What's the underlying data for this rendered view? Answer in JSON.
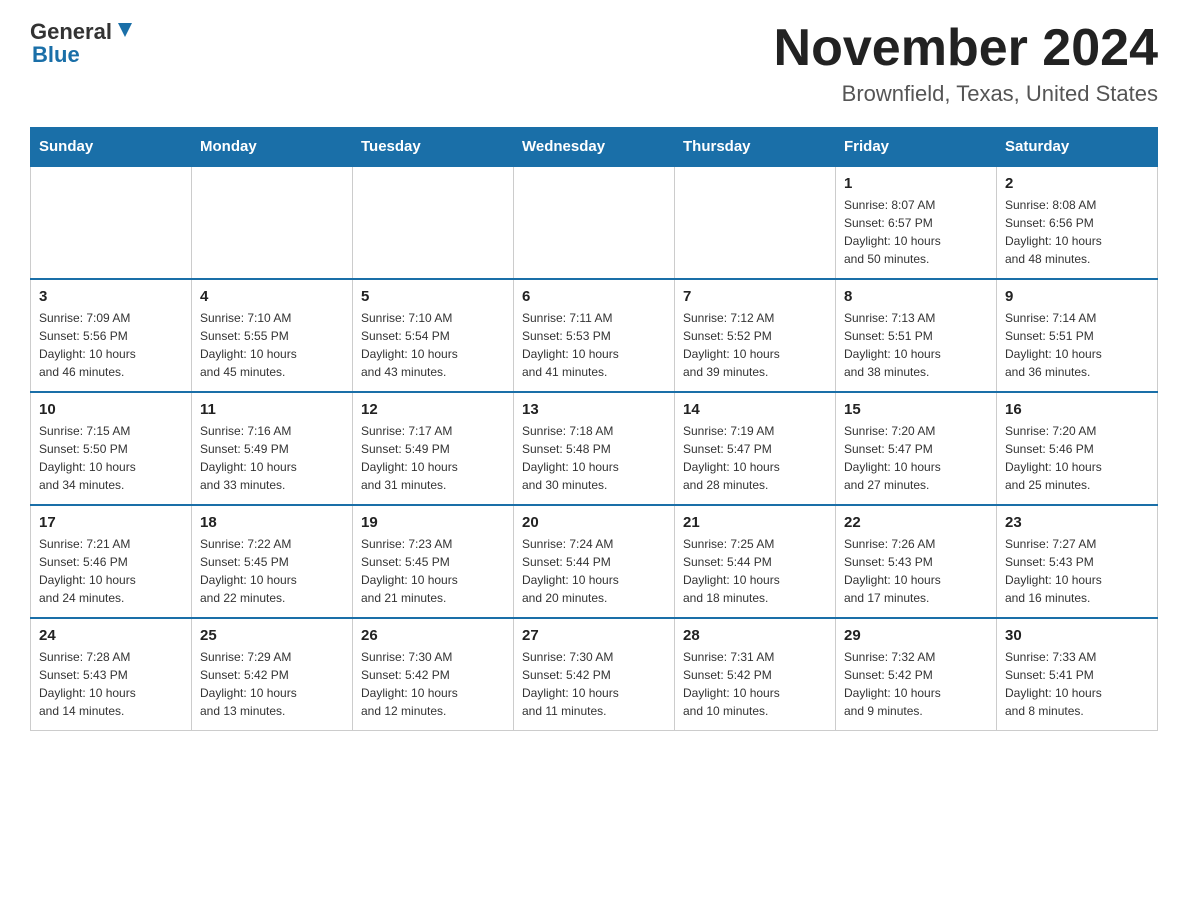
{
  "logo": {
    "text_general": "General",
    "text_blue": "Blue"
  },
  "title": "November 2024",
  "subtitle": "Brownfield, Texas, United States",
  "days_of_week": [
    "Sunday",
    "Monday",
    "Tuesday",
    "Wednesday",
    "Thursday",
    "Friday",
    "Saturday"
  ],
  "weeks": [
    [
      {
        "day": "",
        "info": ""
      },
      {
        "day": "",
        "info": ""
      },
      {
        "day": "",
        "info": ""
      },
      {
        "day": "",
        "info": ""
      },
      {
        "day": "",
        "info": ""
      },
      {
        "day": "1",
        "info": "Sunrise: 8:07 AM\nSunset: 6:57 PM\nDaylight: 10 hours\nand 50 minutes."
      },
      {
        "day": "2",
        "info": "Sunrise: 8:08 AM\nSunset: 6:56 PM\nDaylight: 10 hours\nand 48 minutes."
      }
    ],
    [
      {
        "day": "3",
        "info": "Sunrise: 7:09 AM\nSunset: 5:56 PM\nDaylight: 10 hours\nand 46 minutes."
      },
      {
        "day": "4",
        "info": "Sunrise: 7:10 AM\nSunset: 5:55 PM\nDaylight: 10 hours\nand 45 minutes."
      },
      {
        "day": "5",
        "info": "Sunrise: 7:10 AM\nSunset: 5:54 PM\nDaylight: 10 hours\nand 43 minutes."
      },
      {
        "day": "6",
        "info": "Sunrise: 7:11 AM\nSunset: 5:53 PM\nDaylight: 10 hours\nand 41 minutes."
      },
      {
        "day": "7",
        "info": "Sunrise: 7:12 AM\nSunset: 5:52 PM\nDaylight: 10 hours\nand 39 minutes."
      },
      {
        "day": "8",
        "info": "Sunrise: 7:13 AM\nSunset: 5:51 PM\nDaylight: 10 hours\nand 38 minutes."
      },
      {
        "day": "9",
        "info": "Sunrise: 7:14 AM\nSunset: 5:51 PM\nDaylight: 10 hours\nand 36 minutes."
      }
    ],
    [
      {
        "day": "10",
        "info": "Sunrise: 7:15 AM\nSunset: 5:50 PM\nDaylight: 10 hours\nand 34 minutes."
      },
      {
        "day": "11",
        "info": "Sunrise: 7:16 AM\nSunset: 5:49 PM\nDaylight: 10 hours\nand 33 minutes."
      },
      {
        "day": "12",
        "info": "Sunrise: 7:17 AM\nSunset: 5:49 PM\nDaylight: 10 hours\nand 31 minutes."
      },
      {
        "day": "13",
        "info": "Sunrise: 7:18 AM\nSunset: 5:48 PM\nDaylight: 10 hours\nand 30 minutes."
      },
      {
        "day": "14",
        "info": "Sunrise: 7:19 AM\nSunset: 5:47 PM\nDaylight: 10 hours\nand 28 minutes."
      },
      {
        "day": "15",
        "info": "Sunrise: 7:20 AM\nSunset: 5:47 PM\nDaylight: 10 hours\nand 27 minutes."
      },
      {
        "day": "16",
        "info": "Sunrise: 7:20 AM\nSunset: 5:46 PM\nDaylight: 10 hours\nand 25 minutes."
      }
    ],
    [
      {
        "day": "17",
        "info": "Sunrise: 7:21 AM\nSunset: 5:46 PM\nDaylight: 10 hours\nand 24 minutes."
      },
      {
        "day": "18",
        "info": "Sunrise: 7:22 AM\nSunset: 5:45 PM\nDaylight: 10 hours\nand 22 minutes."
      },
      {
        "day": "19",
        "info": "Sunrise: 7:23 AM\nSunset: 5:45 PM\nDaylight: 10 hours\nand 21 minutes."
      },
      {
        "day": "20",
        "info": "Sunrise: 7:24 AM\nSunset: 5:44 PM\nDaylight: 10 hours\nand 20 minutes."
      },
      {
        "day": "21",
        "info": "Sunrise: 7:25 AM\nSunset: 5:44 PM\nDaylight: 10 hours\nand 18 minutes."
      },
      {
        "day": "22",
        "info": "Sunrise: 7:26 AM\nSunset: 5:43 PM\nDaylight: 10 hours\nand 17 minutes."
      },
      {
        "day": "23",
        "info": "Sunrise: 7:27 AM\nSunset: 5:43 PM\nDaylight: 10 hours\nand 16 minutes."
      }
    ],
    [
      {
        "day": "24",
        "info": "Sunrise: 7:28 AM\nSunset: 5:43 PM\nDaylight: 10 hours\nand 14 minutes."
      },
      {
        "day": "25",
        "info": "Sunrise: 7:29 AM\nSunset: 5:42 PM\nDaylight: 10 hours\nand 13 minutes."
      },
      {
        "day": "26",
        "info": "Sunrise: 7:30 AM\nSunset: 5:42 PM\nDaylight: 10 hours\nand 12 minutes."
      },
      {
        "day": "27",
        "info": "Sunrise: 7:30 AM\nSunset: 5:42 PM\nDaylight: 10 hours\nand 11 minutes."
      },
      {
        "day": "28",
        "info": "Sunrise: 7:31 AM\nSunset: 5:42 PM\nDaylight: 10 hours\nand 10 minutes."
      },
      {
        "day": "29",
        "info": "Sunrise: 7:32 AM\nSunset: 5:42 PM\nDaylight: 10 hours\nand 9 minutes."
      },
      {
        "day": "30",
        "info": "Sunrise: 7:33 AM\nSunset: 5:41 PM\nDaylight: 10 hours\nand 8 minutes."
      }
    ]
  ]
}
